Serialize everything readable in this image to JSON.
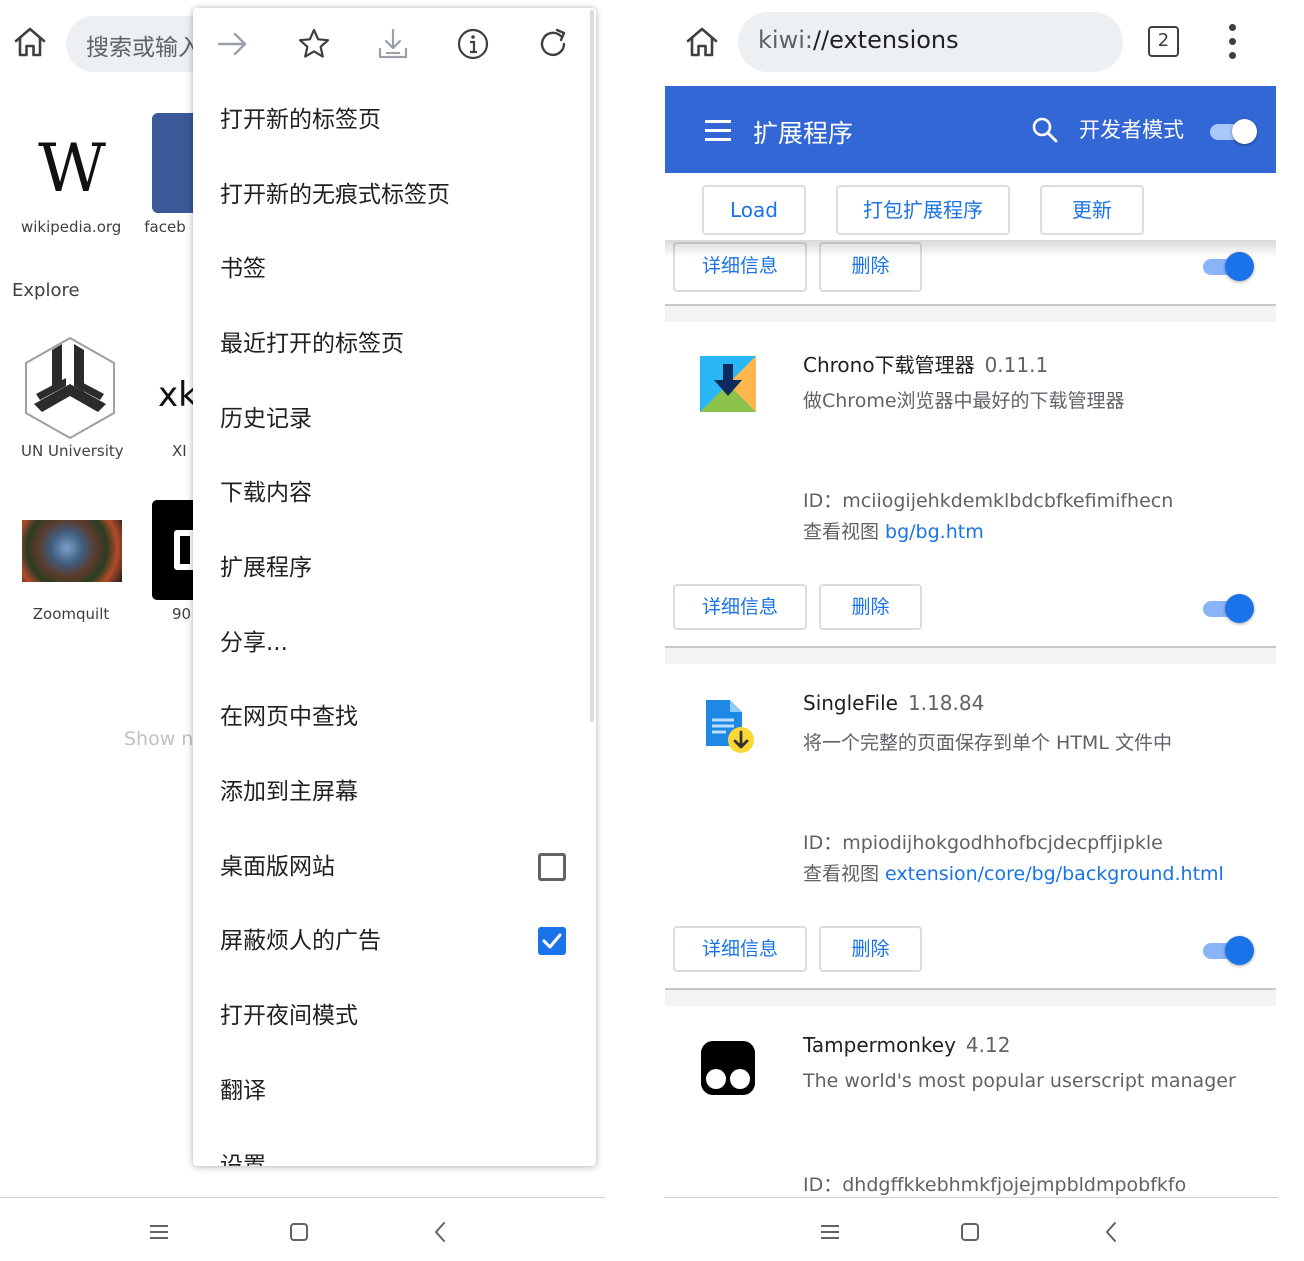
{
  "left": {
    "search_placeholder": "搜索或输入",
    "tiles": [
      {
        "label": "wikipedia.org"
      },
      {
        "label": "faceb"
      }
    ],
    "explore_title": "Explore",
    "explore_tiles": [
      {
        "label": "UN University"
      },
      {
        "label": "XI"
      },
      {
        "label": "Zoomquilt"
      },
      {
        "label": "90"
      }
    ],
    "show_more": "Show n",
    "menu": {
      "icons": [
        "forward-icon",
        "star-icon",
        "download-icon",
        "info-icon",
        "refresh-icon"
      ],
      "items": [
        {
          "label": "打开新的标签页"
        },
        {
          "label": "打开新的无痕式标签页"
        },
        {
          "label": "书签"
        },
        {
          "label": "最近打开的标签页"
        },
        {
          "label": "历史记录"
        },
        {
          "label": "下载内容"
        },
        {
          "label": "扩展程序"
        },
        {
          "label": "分享..."
        },
        {
          "label": "在网页中查找"
        },
        {
          "label": "添加到主屏幕"
        },
        {
          "label": "桌面版网站",
          "checked": false
        },
        {
          "label": "屏蔽烦人的广告",
          "checked": true
        },
        {
          "label": "打开夜间模式"
        },
        {
          "label": "翻译"
        },
        {
          "label": "设置"
        }
      ]
    }
  },
  "right": {
    "url_scheme": "kiwi:",
    "url_path": "//extensions",
    "tab_count": "2",
    "header": {
      "title": "扩展程序",
      "developer_mode_label": "开发者模式",
      "developer_mode_on": true
    },
    "toolbar": {
      "load_label": "Load",
      "pack_label": "打包扩展程序",
      "update_label": "更新"
    },
    "details_label": "详细信息",
    "remove_label": "删除",
    "id_prefix": "ID：",
    "view_prefix": "查看视图",
    "extensions": [
      {
        "name": "Chrono下载管理器",
        "version": "0.11.1",
        "description": "做Chrome浏览器中最好的下载管理器",
        "id": "mciiogijehkdemklbdcbfkefimifhecn",
        "view": "bg/bg.htm",
        "enabled": true
      },
      {
        "name": "SingleFile",
        "version": "1.18.84",
        "description": "将一个完整的页面保存到单个 HTML 文件中",
        "id": "mpiodijhokgodhhofbcjdecpffjipkle",
        "view": "extension/core/bg/background.html",
        "enabled": true
      },
      {
        "name": "Tampermonkey",
        "version": "4.12",
        "description": "The world's most popular userscript manager",
        "id": "dhdgffkkebhmkfjojejmpbldmpobfkfo",
        "enabled": true
      }
    ]
  },
  "colors": {
    "accent": "#1a73e8",
    "header": "#3367d6"
  }
}
